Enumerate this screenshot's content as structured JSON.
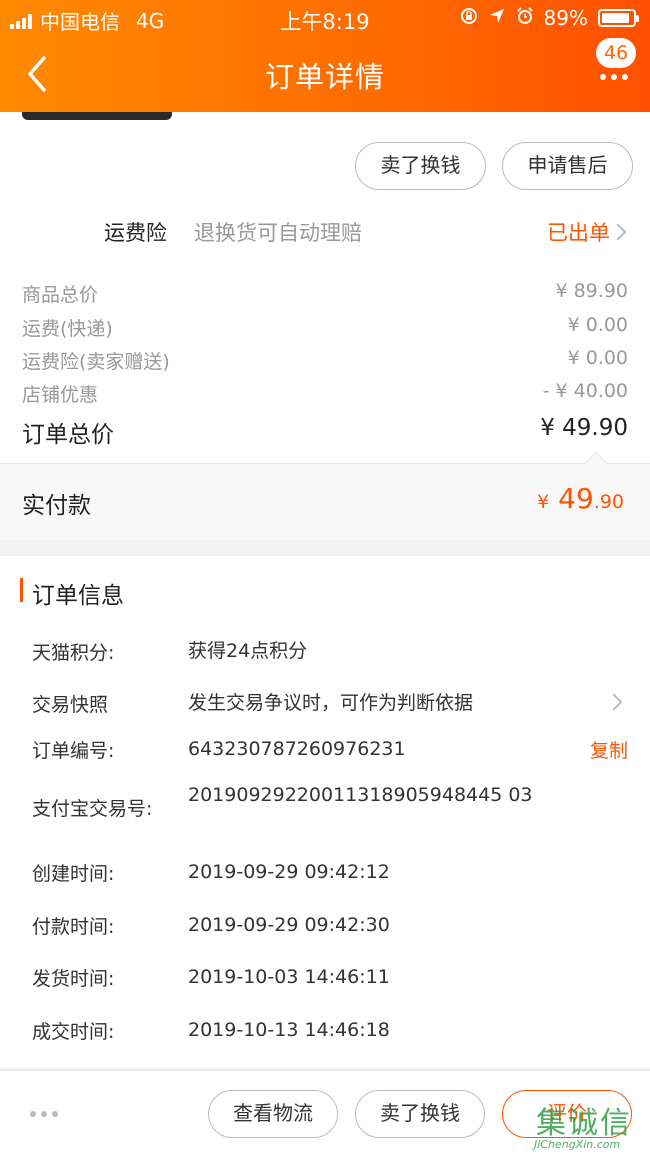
{
  "status_bar": {
    "carrier": "中国电信",
    "network": "4G",
    "time": "上午8:19",
    "battery": "89%",
    "battery_level": 0.89
  },
  "nav": {
    "title": "订单详情",
    "badge": "46"
  },
  "actions_top": {
    "sell_label": "卖了换钱",
    "after_sale_label": "申请售后"
  },
  "insurance": {
    "label": "运费险",
    "desc": "退换货可自动理赔",
    "status": "已出单"
  },
  "price": {
    "rows": [
      {
        "label": "商品总价",
        "value": "¥ 89.90"
      },
      {
        "label": "运费(快递)",
        "value": "¥ 0.00"
      },
      {
        "label": "运费险(卖家赠送)",
        "value": "¥ 0.00"
      },
      {
        "label": "店铺优惠",
        "value": "- ¥ 40.00"
      }
    ],
    "total_label": "订单总价",
    "total_value": "¥ 49.90",
    "paid_label": "实付款",
    "paid_currency": "¥",
    "paid_integer": " 49",
    "paid_decimal": ".90"
  },
  "order_info": {
    "title": "订单信息",
    "rows": [
      {
        "key": "天猫积分:",
        "value": "获得24点积分"
      },
      {
        "key": "交易快照",
        "value": "发生交易争议时，可作为判断依据"
      },
      {
        "key": "订单编号:",
        "value": "643230787260976231"
      },
      {
        "key": "支付宝交易号:",
        "value": "20190929220011318905948445 03"
      },
      {
        "key": "创建时间:",
        "value": "2019-09-29 09:42:12"
      },
      {
        "key": "付款时间:",
        "value": "2019-09-29 09:42:30"
      },
      {
        "key": "发货时间:",
        "value": "2019-10-03 14:46:11"
      },
      {
        "key": "成交时间:",
        "value": "2019-10-13 14:46:18"
      }
    ],
    "copy_label": "复制"
  },
  "bottom_bar": {
    "logistics_label": "查看物流",
    "sell_label": "卖了换钱",
    "review_label": "评价"
  },
  "watermark": {
    "cn": "集诚信",
    "en": "JiChengXin.com"
  },
  "colors": {
    "header_start": "#ff8a00",
    "header_end": "#ff5000",
    "accent": "#ff5500"
  }
}
